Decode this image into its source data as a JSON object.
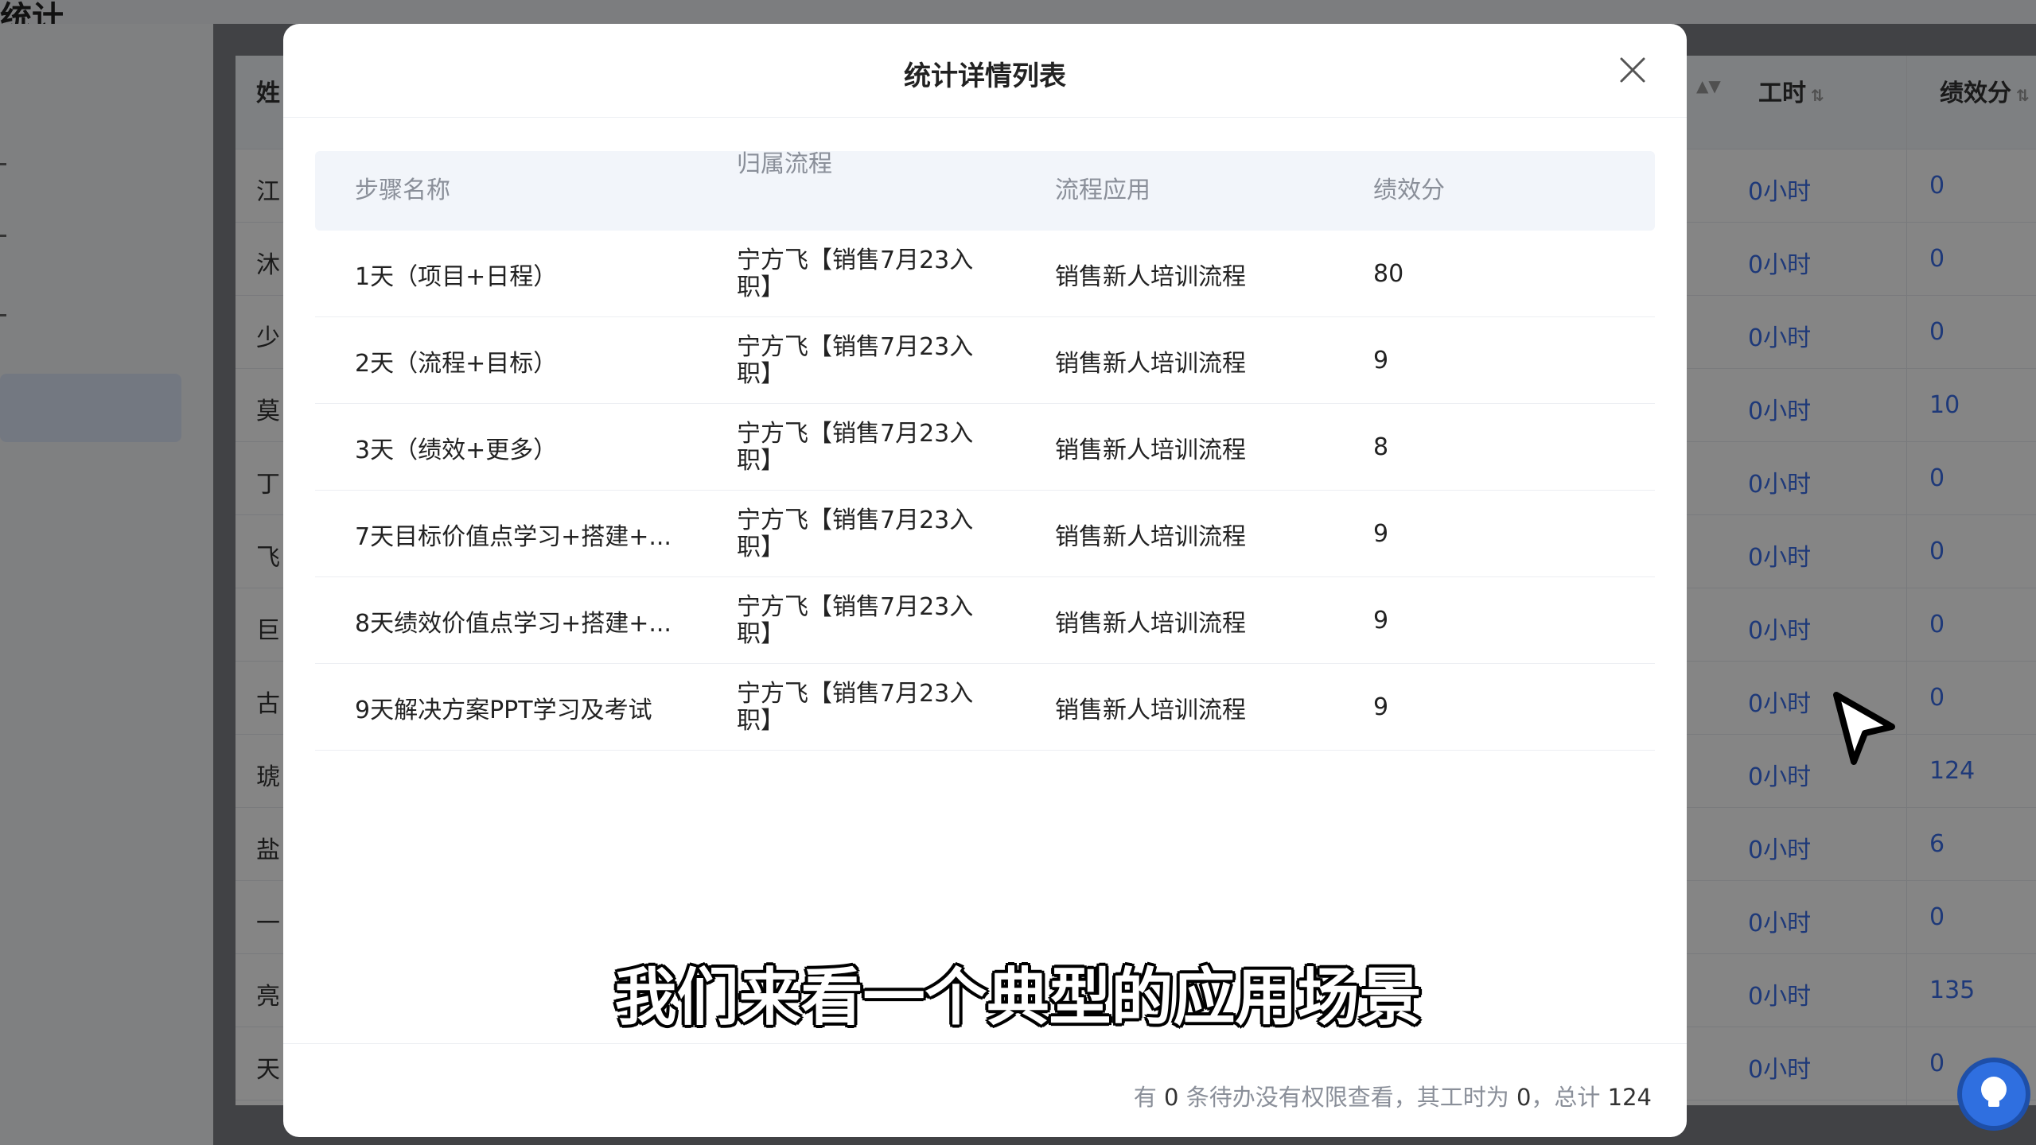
{
  "background": {
    "top_title": "统计",
    "headers": {
      "name": "姓",
      "hours": "工时",
      "score": "绩效分"
    },
    "rows": [
      {
        "name": "江",
        "hours": "0小时",
        "score": "0"
      },
      {
        "name": "沐",
        "hours": "0小时",
        "score": "0"
      },
      {
        "name": "少",
        "hours": "0小时",
        "score": "0"
      },
      {
        "name": "莫",
        "hours": "0小时",
        "score": "10"
      },
      {
        "name": "丁",
        "hours": "0小时",
        "score": "0"
      },
      {
        "name": "飞",
        "hours": "0小时",
        "score": "0"
      },
      {
        "name": "巨",
        "hours": "0小时",
        "score": "0"
      },
      {
        "name": "古",
        "hours": "0小时",
        "score": "0"
      },
      {
        "name": "琥",
        "hours": "0小时",
        "score": "124"
      },
      {
        "name": "盐",
        "hours": "0小时",
        "score": "6"
      },
      {
        "name": "一",
        "hours": "0小时",
        "score": "0"
      },
      {
        "name": "亮",
        "hours": "0小时",
        "score": "135"
      },
      {
        "name": "天",
        "hours": "0小时",
        "score": "0"
      }
    ]
  },
  "modal": {
    "title": "统计详情列表",
    "columns": [
      "步骤名称",
      "归属流程",
      "流程应用",
      "绩效分"
    ],
    "rows": [
      {
        "step": "1天（项目+日程）",
        "process": "宁方飞【销售7月23入职】",
        "app": "销售新人培训流程",
        "score": "80"
      },
      {
        "step": "2天（流程+目标）",
        "process": "宁方飞【销售7月23入职】",
        "app": "销售新人培训流程",
        "score": "9"
      },
      {
        "step": "3天（绩效+更多）",
        "process": "宁方飞【销售7月23入职】",
        "app": "销售新人培训流程",
        "score": "8"
      },
      {
        "step": "7天目标价值点学习+搭建+...",
        "process": "宁方飞【销售7月23入职】",
        "app": "销售新人培训流程",
        "score": "9"
      },
      {
        "step": "8天绩效价值点学习+搭建+...",
        "process": "宁方飞【销售7月23入职】",
        "app": "销售新人培训流程",
        "score": "9"
      },
      {
        "step": "9天解决方案PPT学习及考试",
        "process": "宁方飞【销售7月23入职】",
        "app": "销售新人培训流程",
        "score": "9"
      }
    ],
    "footer": {
      "prefix": "有",
      "pending": "0",
      "middle": "条待办没有权限查看，其工时为",
      "hours": "0",
      "sep": "，总计",
      "total": "124"
    }
  },
  "caption": "我们来看一个典型的应用场景",
  "icons": {
    "close": "close-icon",
    "cursor": "mouse-cursor-icon",
    "help": "lightbulb-icon"
  },
  "colors": {
    "accent": "#3b6ee8",
    "help_button": "#2f6fe0"
  }
}
